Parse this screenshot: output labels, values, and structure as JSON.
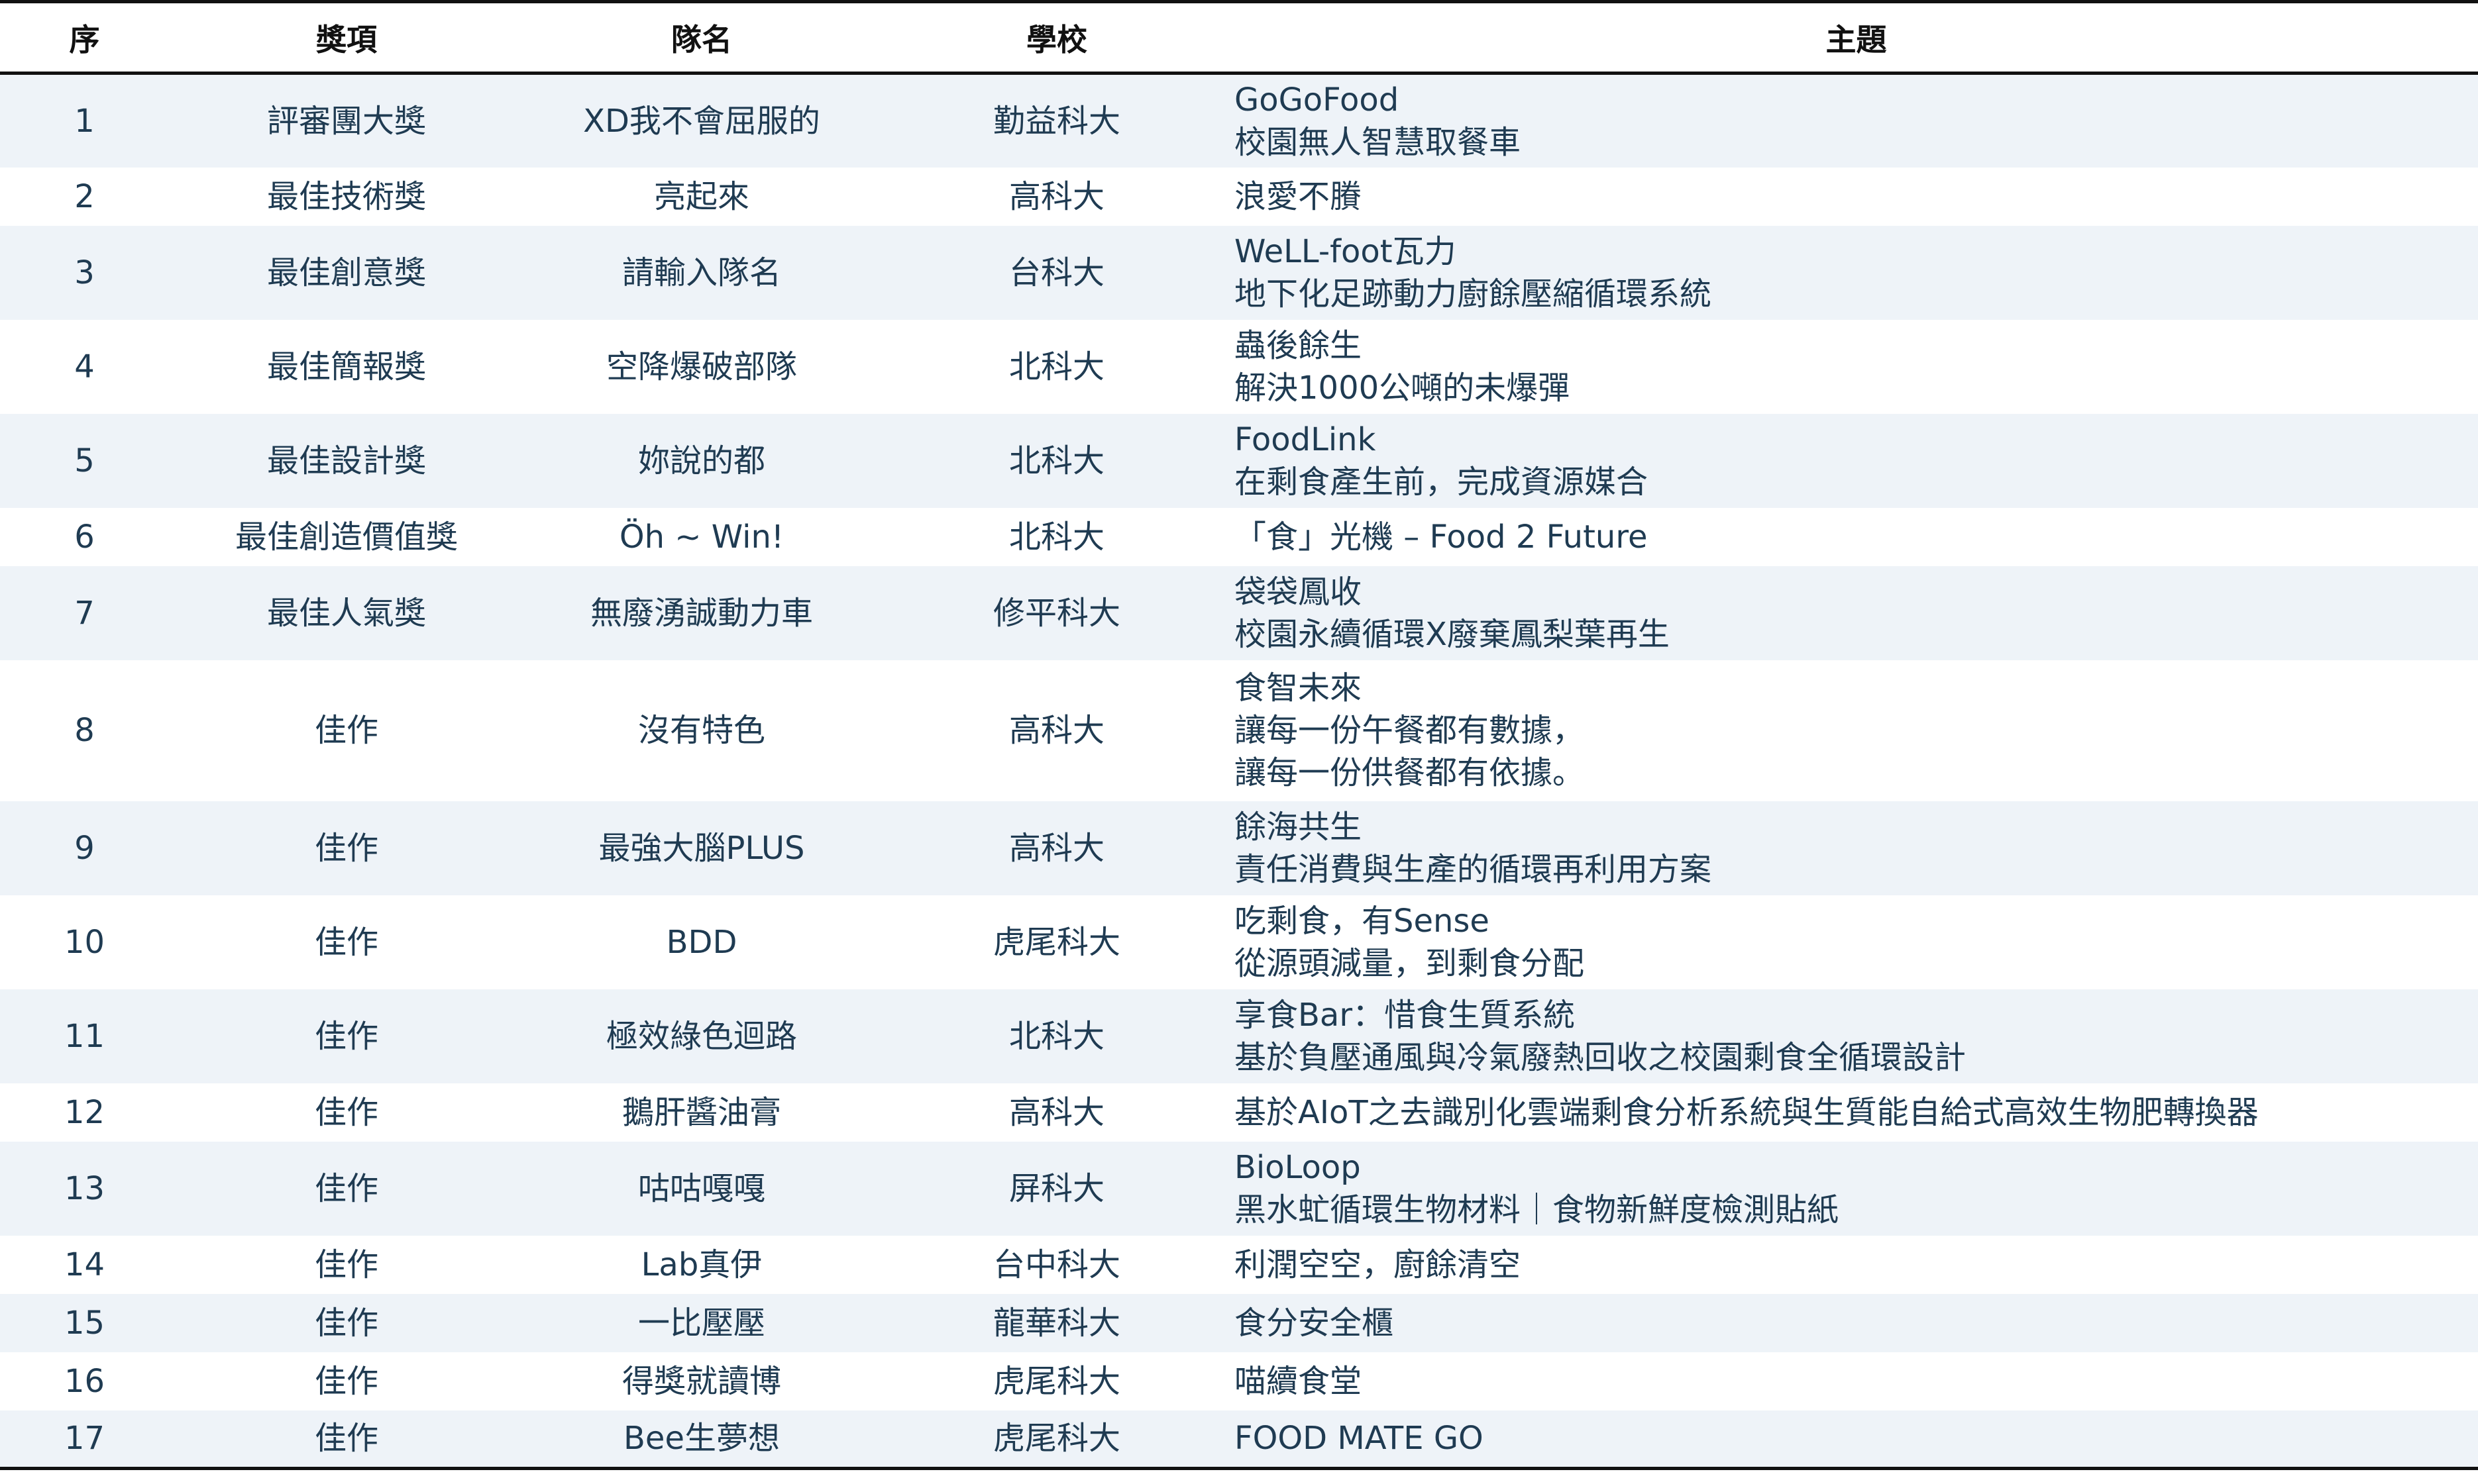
{
  "headers": {
    "seq": "序",
    "award": "獎項",
    "team": "隊名",
    "school": "學校",
    "topic": "主題"
  },
  "rows": [
    {
      "seq": "1",
      "award": "評審團大獎",
      "team": "XD我不會屈服的",
      "school": "勤益科大",
      "topic": [
        "GoGoFood",
        "校園無人智慧取餐車"
      ]
    },
    {
      "seq": "2",
      "award": "最佳技術獎",
      "team": "亮起來",
      "school": "高科大",
      "topic": [
        "浪愛不賸"
      ]
    },
    {
      "seq": "3",
      "award": "最佳創意獎",
      "team": "請輸入隊名",
      "school": "台科大",
      "topic": [
        "WeLL-foot瓦力",
        "地下化足跡動力廚餘壓縮循環系統"
      ]
    },
    {
      "seq": "4",
      "award": "最佳簡報獎",
      "team": "空降爆破部隊",
      "school": "北科大",
      "topic": [
        "蟲後餘生",
        "解決1000公噸的未爆彈"
      ]
    },
    {
      "seq": "5",
      "award": "最佳設計獎",
      "team": "妳說的都",
      "school": "北科大",
      "topic": [
        "FoodLink",
        "在剩食產生前，完成資源媒合"
      ]
    },
    {
      "seq": "6",
      "award": "最佳創造價值獎",
      "team": "Öh ~ Win!",
      "school": "北科大",
      "topic": [
        "「食」光機 – Food 2 Future"
      ]
    },
    {
      "seq": "7",
      "award": "最佳人氣獎",
      "team": "無廢湧誠動力車",
      "school": "修平科大",
      "topic": [
        "袋袋鳳收",
        "校園永續循環X廢棄鳳梨葉再生"
      ]
    },
    {
      "seq": "8",
      "award": "佳作",
      "team": "沒有特色",
      "school": "高科大",
      "topic": [
        "食智未來",
        "讓每一份午餐都有數據，",
        "讓每一份供餐都有依據。"
      ]
    },
    {
      "seq": "9",
      "award": "佳作",
      "team": "最強大腦PLUS",
      "school": "高科大",
      "topic": [
        "餘海共生",
        "責任消費與生產的循環再利用方案"
      ]
    },
    {
      "seq": "10",
      "award": "佳作",
      "team": "BDD",
      "school": "虎尾科大",
      "topic": [
        "吃剩食，有Sense",
        "從源頭減量，到剩食分配"
      ]
    },
    {
      "seq": "11",
      "award": "佳作",
      "team": "極效綠色迴路",
      "school": "北科大",
      "topic": [
        "享食Bar：惜食生質系統",
        "基於負壓通風與冷氣廢熱回收之校園剩食全循環設計"
      ]
    },
    {
      "seq": "12",
      "award": "佳作",
      "team": "鵝肝醬油膏",
      "school": "高科大",
      "topic": [
        "基於AIoT之去識別化雲端剩食分析系統與生質能自給式高效生物肥轉換器"
      ]
    },
    {
      "seq": "13",
      "award": "佳作",
      "team": "咕咕嘎嘎",
      "school": "屏科大",
      "topic": [
        "BioLoop",
        "黑水虻循環生物材料｜食物新鮮度檢測貼紙"
      ]
    },
    {
      "seq": "14",
      "award": "佳作",
      "team": "Lab真伊",
      "school": "台中科大",
      "topic": [
        "利潤空空，廚餘清空"
      ]
    },
    {
      "seq": "15",
      "award": "佳作",
      "team": "一比壓壓",
      "school": "龍華科大",
      "topic": [
        "食分安全櫃"
      ]
    },
    {
      "seq": "16",
      "award": "佳作",
      "team": "得獎就讀博",
      "school": "虎尾科大",
      "topic": [
        "喵續食堂"
      ]
    },
    {
      "seq": "17",
      "award": "佳作",
      "team": "Bee生夢想",
      "school": "虎尾科大",
      "topic": [
        "FOOD MATE GO"
      ]
    }
  ]
}
